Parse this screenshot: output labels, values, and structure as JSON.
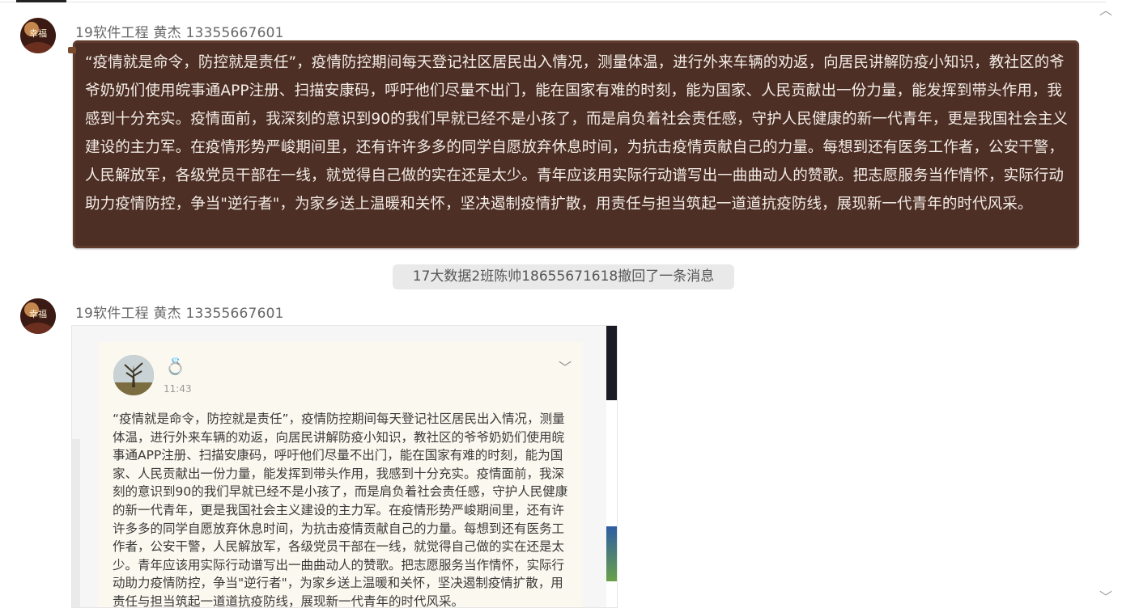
{
  "messages": [
    {
      "sender": "19软件工程 黄杰 13355667601",
      "text": "“疫情就是命令，防控就是责任”，疫情防控期间每天登记社区居民出入情况，测量体温，进行外来车辆的劝返，向居民讲解防疫小知识，教社区的爷爷奶奶们使用皖事通APP注册、扫描安康码，呼吁他们尽量不出门，能在国家有难的时刻，能为国家、人民贡献出一份力量，能发挥到带头作用，我感到十分充实。疫情面前，我深刻的意识到90的我们早就已经不是小孩了，而是肩负着社会责任感，守护人民健康的新一代青年，更是我国社会主义建设的主力军。在疫情形势严峻期间里，还有许许多多的同学自愿放弃休息时间，为抗击疫情贡献自己的力量。每想到还有医务工作者，公安干警，人民解放军，各级党员干部在一线，就觉得自己做的实在还是太少。青年应该用实际行动谱写出一曲曲动人的赞歌。把志愿服务当作情怀，实际行动助力疫情防控，争当\"逆行者\"，为家乡送上温暖和关怀，坚决遏制疫情扩散，用责任与担当筑起一道道抗疫防线，展现新一代青年的时代风采。"
    },
    {
      "recall_notice": "17大数据2班陈帅18655671618撤回了一条消息"
    },
    {
      "sender": "19软件工程 黄杰 13355667601",
      "image_post": {
        "time": "11:43",
        "text": "“疫情就是命令，防控就是责任”，疫情防控期间每天登记社区居民出入情况，测量体温，进行外来车辆的劝返，向居民讲解防疫小知识，教社区的爷爷奶奶们使用皖事通APP注册、扫描安康码，呼吁他们尽量不出门，能在国家有难的时刻，能为国家、人民贡献出一份力量，能发挥到带头作用，我感到十分充实。疫情面前，我深刻的意识到90的我们早就已经不是小孩了，而是肩负着社会责任感，守护人民健康的新一代青年，更是我国社会主义建设的主力军。在疫情形势严峻期间里，还有许许多多的同学自愿放弃休息时间，为抗击疫情贡献自己的力量。每想到还有医务工作者，公安干警，人民解放军，各级党员干部在一线，就觉得自己做的实在还是太少。青年应该用实际行动谱写出一曲曲动人的赞歌。把志愿服务当作情怀，实际行动助力疫情防控，争当\"逆行者\"，为家乡送上温暖和关怀，坚决遏制疫情扩散，用责任与担当筑起一道道抗疫防线，展现新一代青年的时代风采。"
      }
    }
  ],
  "avatar_text": "幸福",
  "colors": {
    "bubble_bg": "#4d2f25",
    "bubble_text": "#f3ece6",
    "recall_bg": "#e9e9e9",
    "post_bg": "#fbf8ef"
  },
  "icons": {
    "scroll_up": "chevron-up-icon",
    "scroll_down": "chevron-down-icon",
    "post_menu": "chevron-down-icon",
    "ring": "ring-icon"
  }
}
